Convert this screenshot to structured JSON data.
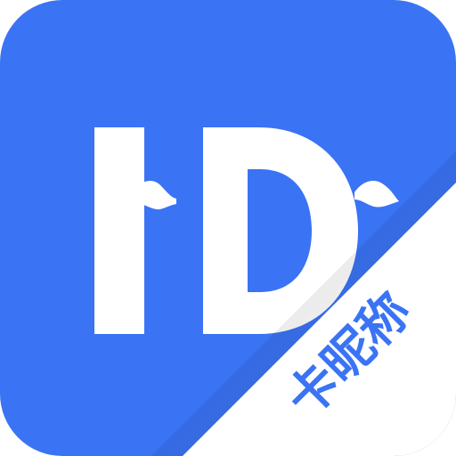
{
  "app_icon": {
    "corner_label": "卡昵称",
    "logo_letters": "ID",
    "colors": {
      "background": "#3a73f4",
      "corner_band": "#ffffff",
      "logo_letters": "#ffffff",
      "corner_label": "#3a73f4"
    }
  }
}
